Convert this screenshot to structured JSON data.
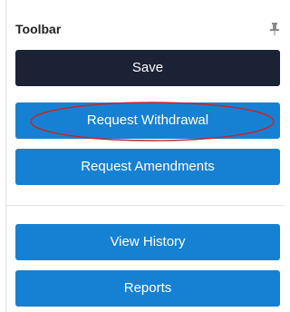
{
  "toolbar": {
    "title": "Toolbar",
    "pin_icon": "pin-icon",
    "buttons": [
      {
        "label": "Save",
        "style": "dark"
      },
      {
        "label": "Request Withdrawal",
        "style": "blue"
      },
      {
        "label": "Request Amendments",
        "style": "blue"
      },
      {
        "label": "View History",
        "style": "blue"
      },
      {
        "label": "Reports",
        "style": "blue"
      }
    ]
  },
  "colors": {
    "dark_button": "#1b2236",
    "blue_button": "#1681d2",
    "annotation": "#c0282d"
  }
}
